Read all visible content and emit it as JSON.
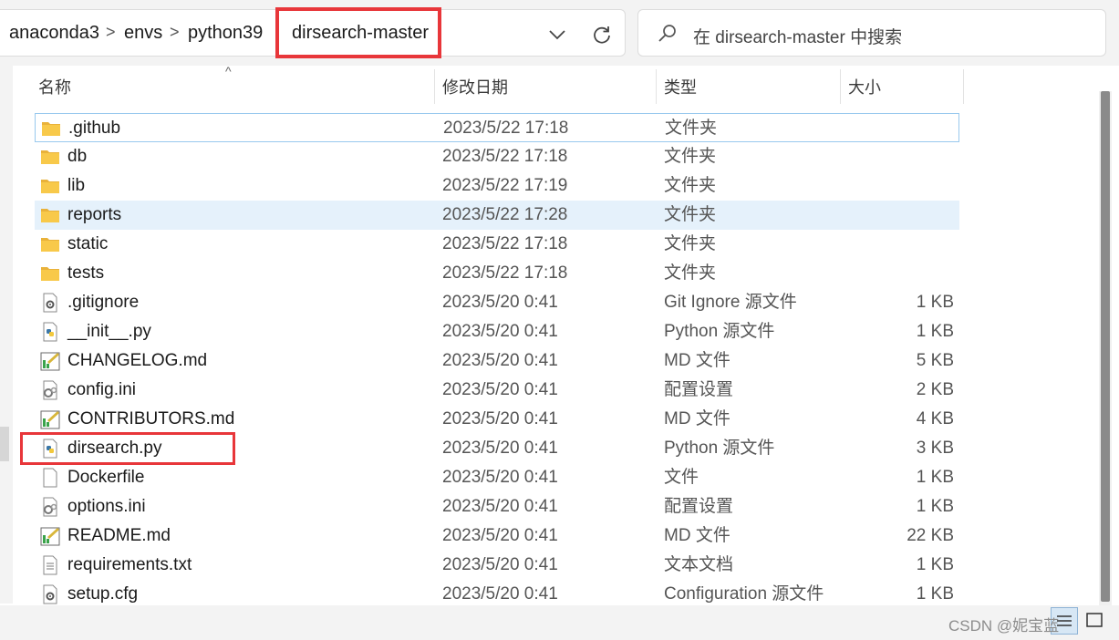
{
  "breadcrumb": {
    "items": [
      "anaconda3",
      "envs",
      "python39",
      "dirsearch-master"
    ],
    "separator": ">"
  },
  "search": {
    "placeholder": "在 dirsearch-master 中搜索"
  },
  "columns": {
    "name": "名称",
    "date": "修改日期",
    "type": "类型",
    "size": "大小"
  },
  "files": [
    {
      "name": ".github",
      "date": "2023/5/22 17:18",
      "type": "文件夹",
      "size": "",
      "icon": "folder-icon"
    },
    {
      "name": "db",
      "date": "2023/5/22 17:18",
      "type": "文件夹",
      "size": "",
      "icon": "folder-icon"
    },
    {
      "name": "lib",
      "date": "2023/5/22 17:19",
      "type": "文件夹",
      "size": "",
      "icon": "folder-icon"
    },
    {
      "name": "reports",
      "date": "2023/5/22 17:28",
      "type": "文件夹",
      "size": "",
      "icon": "folder-icon"
    },
    {
      "name": "static",
      "date": "2023/5/22 17:18",
      "type": "文件夹",
      "size": "",
      "icon": "folder-icon"
    },
    {
      "name": "tests",
      "date": "2023/5/22 17:18",
      "type": "文件夹",
      "size": "",
      "icon": "folder-icon"
    },
    {
      "name": ".gitignore",
      "date": "2023/5/20 0:41",
      "type": "Git Ignore 源文件",
      "size": "1 KB",
      "icon": "gear-file-icon"
    },
    {
      "name": "__init__.py",
      "date": "2023/5/20 0:41",
      "type": "Python 源文件",
      "size": "1 KB",
      "icon": "python-file-icon"
    },
    {
      "name": "CHANGELOG.md",
      "date": "2023/5/20 0:41",
      "type": "MD 文件",
      "size": "5 KB",
      "icon": "markdown-file-icon"
    },
    {
      "name": "config.ini",
      "date": "2023/5/20 0:41",
      "type": "配置设置",
      "size": "2 KB",
      "icon": "settings-file-icon"
    },
    {
      "name": "CONTRIBUTORS.md",
      "date": "2023/5/20 0:41",
      "type": "MD 文件",
      "size": "4 KB",
      "icon": "markdown-file-icon"
    },
    {
      "name": "dirsearch.py",
      "date": "2023/5/20 0:41",
      "type": "Python 源文件",
      "size": "3 KB",
      "icon": "python-file-icon"
    },
    {
      "name": "Dockerfile",
      "date": "2023/5/20 0:41",
      "type": "文件",
      "size": "1 KB",
      "icon": "blank-file-icon"
    },
    {
      "name": "options.ini",
      "date": "2023/5/20 0:41",
      "type": "配置设置",
      "size": "1 KB",
      "icon": "settings-file-icon"
    },
    {
      "name": "README.md",
      "date": "2023/5/20 0:41",
      "type": "MD 文件",
      "size": "22 KB",
      "icon": "markdown-file-icon"
    },
    {
      "name": "requirements.txt",
      "date": "2023/5/20 0:41",
      "type": "文本文档",
      "size": "1 KB",
      "icon": "text-file-icon"
    },
    {
      "name": "setup.cfg",
      "date": "2023/5/20 0:41",
      "type": "Configuration 源文件",
      "size": "1 KB",
      "icon": "gear-file-icon"
    }
  ],
  "watermark": "CSDN @妮宝蓝",
  "colors": {
    "annotation_red": "#e8363a",
    "row_hover": "#e5f1fb",
    "folder_yellow": "#f8c94a"
  }
}
